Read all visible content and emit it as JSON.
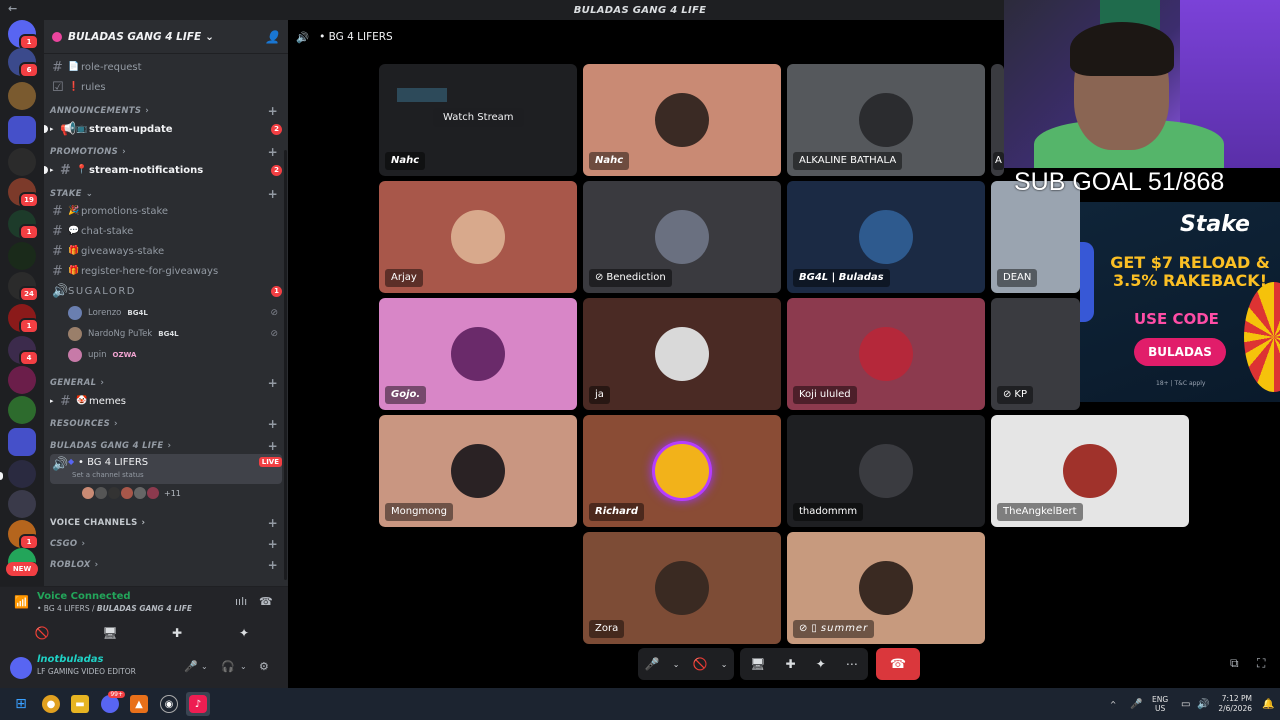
{
  "window": {
    "title": "BULADAS GANG 4 LIFE"
  },
  "server": {
    "name": "BULADAS GANG 4 LIFE"
  },
  "channel_header": {
    "title": "• BG 4 LIFERS"
  },
  "channels": [
    {
      "type": "text",
      "name": "role-request",
      "emoji": "📄"
    },
    {
      "type": "text",
      "name": "rules",
      "emoji": "❗"
    },
    {
      "type": "category",
      "name": "ANNOUNCEMENTS"
    },
    {
      "type": "text",
      "name": "stream-update",
      "emoji": "📺",
      "badge": "2",
      "unread": true
    },
    {
      "type": "category",
      "name": "PROMOTIONS"
    },
    {
      "type": "text",
      "name": "stream-notifications",
      "emoji": "📍",
      "badge": "2",
      "unread": true
    },
    {
      "type": "category",
      "name": "STAKE"
    },
    {
      "type": "text",
      "name": "promotions-stake",
      "emoji": "🎉"
    },
    {
      "type": "text",
      "name": "chat-stake",
      "emoji": "💬"
    },
    {
      "type": "text",
      "name": "giveaways-stake",
      "emoji": "🎁"
    },
    {
      "type": "text",
      "name": "register-here-for-giveaways",
      "emoji": "🎁"
    },
    {
      "type": "voice",
      "name": "SUGALORD",
      "badge": "1"
    }
  ],
  "sugalord_users": [
    {
      "name": "Lorenzo",
      "tag": "BG4L"
    },
    {
      "name": "NardoNg PuTek",
      "tag": "BG4L"
    },
    {
      "name": "upin",
      "tag": "OZWA"
    }
  ],
  "channels_lower": {
    "general": "GENERAL",
    "memes": "memes",
    "resources": "RESOURCES",
    "buladas_cat": "BULADAS GANG 4 LIFE",
    "active_channel": "• BG 4 LIFERS",
    "live": "LIVE",
    "status_hint": "Set a channel status",
    "extra_count": "+11",
    "voice_channels": "VOICE CHANNELS",
    "csgo": "CSGO",
    "roblox": "ROBLOX"
  },
  "voice_panel": {
    "title": "Voice Connected",
    "subtitle_channel": "• BG 4 LIFERS / ",
    "subtitle_server": "BULADAS GANG 4 LIFE"
  },
  "user_panel": {
    "username": "lnotbuladas",
    "status": "LF GAMING VIDEO EDITOR"
  },
  "tiles": [
    {
      "name": "Nahc",
      "watch": "Watch Stream",
      "bg": "#1e1f22"
    },
    {
      "name": "Nahc",
      "bg": "#c98a74"
    },
    {
      "name": "ALKALINE BATHALA",
      "bg": "#55585c"
    },
    {
      "name": "A",
      "bg": "#3a3b40"
    },
    {
      "name": "Arjay",
      "bg": "#a8574a"
    },
    {
      "name": "Benediction",
      "bg": "#3a3a3f"
    },
    {
      "name": "BG4L | Buladas",
      "bg": "#1b2a44"
    },
    {
      "name": "DEAN",
      "bg": "#9aa4b0"
    },
    {
      "name": "Gojo.",
      "bg": "#d886c7"
    },
    {
      "name": "ja",
      "bg": "#4a2a24"
    },
    {
      "name": "Koji ululed",
      "bg": "#8c3a4e"
    },
    {
      "name": "KP",
      "bg": "#3a3b40"
    },
    {
      "name": "Mongmong",
      "bg": "#c99681"
    },
    {
      "name": "Richard",
      "bg": "#8a4c35"
    },
    {
      "name": "thadommm",
      "bg": "#1e1f22"
    },
    {
      "name": "TheAngkelBert",
      "bg": "#e5e5e5"
    },
    {
      "name": "Zora",
      "bg": "#7d4c36"
    },
    {
      "name": "summer",
      "bg": "#c79a7e"
    }
  ],
  "overlay": {
    "sub_goal": "SUB GOAL 51/868",
    "ad_logo": "Stake",
    "ad_promo": "GET $7 RELOAD & 3.5% RAKEBACK!",
    "ad_use_code": "USE CODE",
    "ad_code": "BULADAS",
    "ad_terms": "18+ | T&C apply"
  },
  "taskbar": {
    "lang_top": "ENG",
    "lang_bottom": "US",
    "time": "7:12 PM",
    "date": "2/6/2026",
    "discord_badge": "99+"
  },
  "colors": {
    "accent": "#5865f2",
    "live": "#f23f43",
    "voice_green": "#23a55a",
    "hangup": "#da373c"
  }
}
